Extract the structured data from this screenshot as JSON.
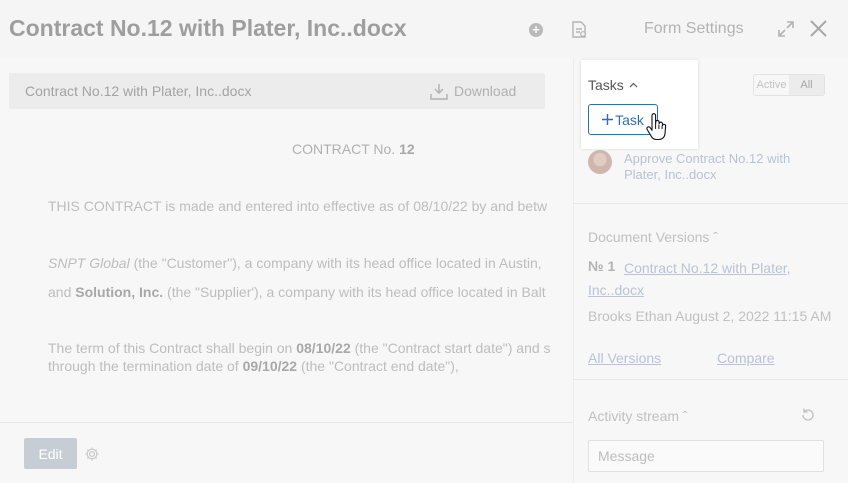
{
  "header": {
    "title": "Contract No.12 with Plater, Inc..docx",
    "form_settings": "Form Settings"
  },
  "file_bar": {
    "file_name": "Contract No.12 with Plater, Inc..docx",
    "download_label": "Download"
  },
  "document": {
    "heading_prefix": "CONTRACT No.",
    "heading_number": "12",
    "p1": "THIS CONTRACT is made and entered into effective as of 08/10/22 by and betw",
    "p2_customer": "SNPT Global",
    "p2_rest": " (the \"Customer\"), a company with its head office located in Austin,",
    "p3_and": "and ",
    "p3_supplier": "Solution, Inc.",
    "p3_rest": " (the \"Supplier'), a company with its head office located in Balt",
    "p4_a": "The term of this Contract shall begin on ",
    "p4_start": "08/10/22",
    "p4_b": " (the \"Contract start date\") and s",
    "p5_a": "through the termination date of ",
    "p5_end": "09/10/22",
    "p5_b": " (the \"Contract end date\"),"
  },
  "bottom": {
    "edit_label": "Edit"
  },
  "tasks": {
    "title": "Tasks",
    "add_label": "Task",
    "filter": {
      "active": "Active",
      "all": "All",
      "selected": "All"
    },
    "items": [
      {
        "label": "Approve Contract No.12 with Plater, Inc..docx"
      }
    ]
  },
  "versions": {
    "title": "Document Versions",
    "number": "№ 1",
    "file_link": "Contract No.12 with Plater, Inc..docx",
    "meta": "Brooks Ethan August 2, 2022 11:15 AM",
    "all_versions": "All Versions",
    "compare": "Compare"
  },
  "activity": {
    "title": "Activity stream",
    "message_placeholder": "Message"
  },
  "colors": {
    "accent": "#2e6fb3",
    "link_muted": "#b9c3d4"
  }
}
